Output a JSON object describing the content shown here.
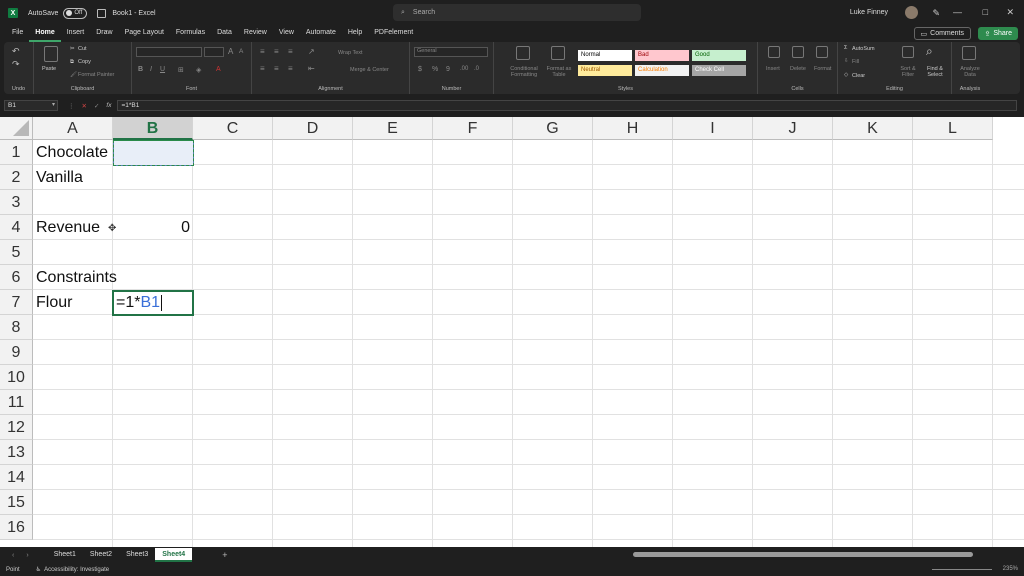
{
  "titlebar": {
    "app_icon": "X",
    "autosave_label": "AutoSave",
    "autosave_state": "Off",
    "workbook_title": "Book1 - Excel",
    "search_placeholder": "Search",
    "user_name": "Luke Finney"
  },
  "tabs": [
    "File",
    "Home",
    "Insert",
    "Draw",
    "Page Layout",
    "Formulas",
    "Data",
    "Review",
    "View",
    "Automate",
    "Help",
    "PDFelement"
  ],
  "active_tab": "Home",
  "header_buttons": {
    "comments": "Comments",
    "share": "Share"
  },
  "ribbon": {
    "undo_label": "Undo",
    "clipboard": {
      "paste": "Paste",
      "cut": "Cut",
      "copy": "Copy",
      "format_painter": "Format Painter",
      "label": "Clipboard"
    },
    "font": {
      "label": "Font"
    },
    "alignment": {
      "wrap_text": "Wrap Text",
      "merge_center": "Merge & Center",
      "label": "Alignment"
    },
    "number": {
      "format": "General",
      "label": "Number"
    },
    "styles": {
      "conditional": "Conditional Formatting",
      "format_table": "Format as Table",
      "cells": [
        {
          "name": "Normal",
          "bg": "#ffffff",
          "fg": "#000000"
        },
        {
          "name": "Bad",
          "bg": "#ffc7ce",
          "fg": "#9c0006"
        },
        {
          "name": "Good",
          "bg": "#c6efce",
          "fg": "#006100"
        },
        {
          "name": "Neutral",
          "bg": "#ffeb9c",
          "fg": "#9c5700"
        },
        {
          "name": "Calculation",
          "bg": "#f2f2f2",
          "fg": "#fa7d00"
        },
        {
          "name": "Check Cell",
          "bg": "#a5a5a5",
          "fg": "#ffffff"
        }
      ],
      "label": "Styles"
    },
    "cells": {
      "insert": "Insert",
      "delete": "Delete",
      "format": "Format",
      "label": "Cells"
    },
    "editing": {
      "autosum": "AutoSum",
      "fill": "Fill",
      "clear": "Clear",
      "sort_filter": "Sort & Filter",
      "find_select": "Find & Select",
      "label": "Editing"
    },
    "analysis": {
      "analyze": "Analyze Data",
      "label": "Analysis"
    }
  },
  "formula_bar": {
    "name_box": "B1",
    "formula": "=1*B1"
  },
  "grid": {
    "columns": [
      "A",
      "B",
      "C",
      "D",
      "E",
      "F",
      "G",
      "H",
      "I",
      "J",
      "K",
      "L"
    ],
    "selected_column": "B",
    "rows": [
      "1",
      "2",
      "3",
      "4",
      "5",
      "6",
      "7",
      "8",
      "9",
      "10",
      "11",
      "12",
      "13",
      "14",
      "15",
      "16"
    ],
    "cells": {
      "A1": "Chocolate",
      "A2": "Vanilla",
      "A4": "Revenue",
      "B4": "0",
      "A6": "Constraints",
      "A7": "Flour"
    },
    "editing_cell": {
      "address": "B7",
      "prefix": "=1*",
      "ref": "B1"
    }
  },
  "sheets": [
    "Sheet1",
    "Sheet2",
    "Sheet3",
    "Sheet4"
  ],
  "active_sheet": "Sheet4",
  "status": {
    "mode": "Point",
    "accessibility": "Accessibility: Investigate",
    "zoom": "235%"
  }
}
